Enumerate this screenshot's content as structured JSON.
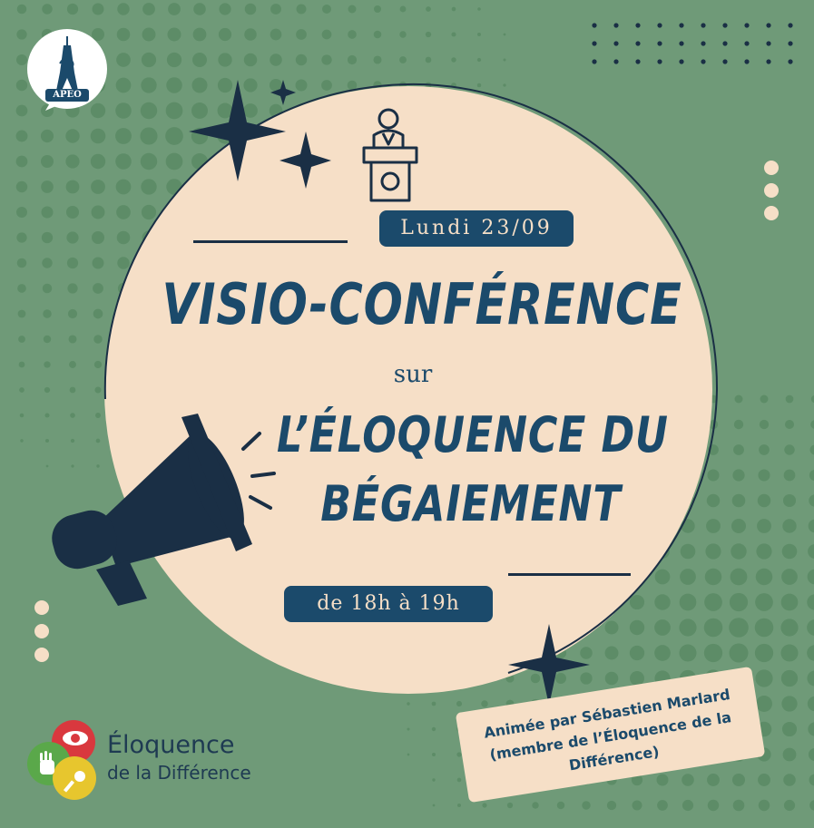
{
  "colors": {
    "background": "#6f9a78",
    "dots": "#5d8c67",
    "circle": "#f6dfc7",
    "navy": "#1b4a6b",
    "dark": "#1a2f45",
    "cream": "#f6dfc7"
  },
  "badge": {
    "org_text": "APEO",
    "icon": "eiffel-tower-icon"
  },
  "event": {
    "date": "Lundi 23/09",
    "title_line1": "VISIO-CONFÉRENCE",
    "connector": "sur",
    "title_line2": "L’ÉLOQUENCE DU",
    "title_line3": "BÉGAIEMENT",
    "time": "de 18h à 19h"
  },
  "credit": {
    "line1": "Animée par Sébastien Marlard",
    "line2": "(membre de l’Éloquence de la",
    "line3": "Différence)"
  },
  "footer_logo": {
    "line1": "Éloquence",
    "line2": "de la Différence",
    "colors": [
      "#d9383e",
      "#5aa84a",
      "#e7c62e"
    ]
  },
  "icons": [
    "speaker-at-podium-icon",
    "megaphone-icon",
    "sparkle-star-icon"
  ]
}
